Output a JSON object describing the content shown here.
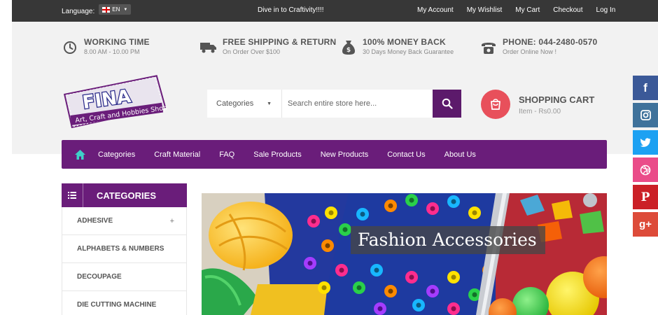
{
  "topbar": {
    "language_label": "Language:",
    "language_value": "EN",
    "promo": "Dive in to Craftivity!!!!",
    "links": [
      "My Account",
      "My Wishlist",
      "My Cart",
      "Checkout",
      "Log In"
    ]
  },
  "features": [
    {
      "title": "WORKING TIME",
      "subtitle": "8.00 AM - 10.00 PM",
      "icon": "clock-icon"
    },
    {
      "title": "FREE SHIPPING & RETURN",
      "subtitle": "On Order Over $100",
      "icon": "truck-icon"
    },
    {
      "title": "100% MONEY BACK",
      "subtitle": "30 Days Money Back Guarantee",
      "icon": "money-bag-icon"
    },
    {
      "title": "PHONE: 044-2480-0570",
      "subtitle": "Order Online Now !",
      "icon": "phone-icon"
    }
  ],
  "logo": {
    "name": "FINA",
    "tagline": "Art, Craft and Hobbies Shop"
  },
  "search": {
    "category_label": "Categories",
    "placeholder": "Search entire store here..."
  },
  "cart": {
    "title": "SHOPPING CART",
    "summary": "Item - Rs0.00"
  },
  "nav": {
    "items": [
      "Categories",
      "Craft Material",
      "FAQ",
      "Sale Products",
      "New Products",
      "Contact Us",
      "About Us"
    ]
  },
  "social": [
    {
      "name": "facebook",
      "glyph": "f",
      "color": "#3b5998"
    },
    {
      "name": "instagram",
      "glyph": "◘",
      "color": "#3f729b"
    },
    {
      "name": "twitter",
      "glyph": "t",
      "color": "#1da1f2"
    },
    {
      "name": "dribbble",
      "glyph": "◎",
      "color": "#ea4c89"
    },
    {
      "name": "pinterest",
      "glyph": "P",
      "color": "#cb2027"
    },
    {
      "name": "google-plus",
      "glyph": "g+",
      "color": "#dd4b39"
    }
  ],
  "sidebar": {
    "title": "CATEGORIES",
    "items": [
      "ADHESIVE",
      "ALPHABETS & NUMBERS",
      "DECOUPAGE",
      "DIE CUTTING MACHINE"
    ]
  },
  "banner": {
    "title": "Fashion Accessories"
  },
  "colors": {
    "brand_purple": "#6a1d7a",
    "cart_red": "#e8505b",
    "topbar": "#373737",
    "home_icon": "#3ed1c8"
  }
}
